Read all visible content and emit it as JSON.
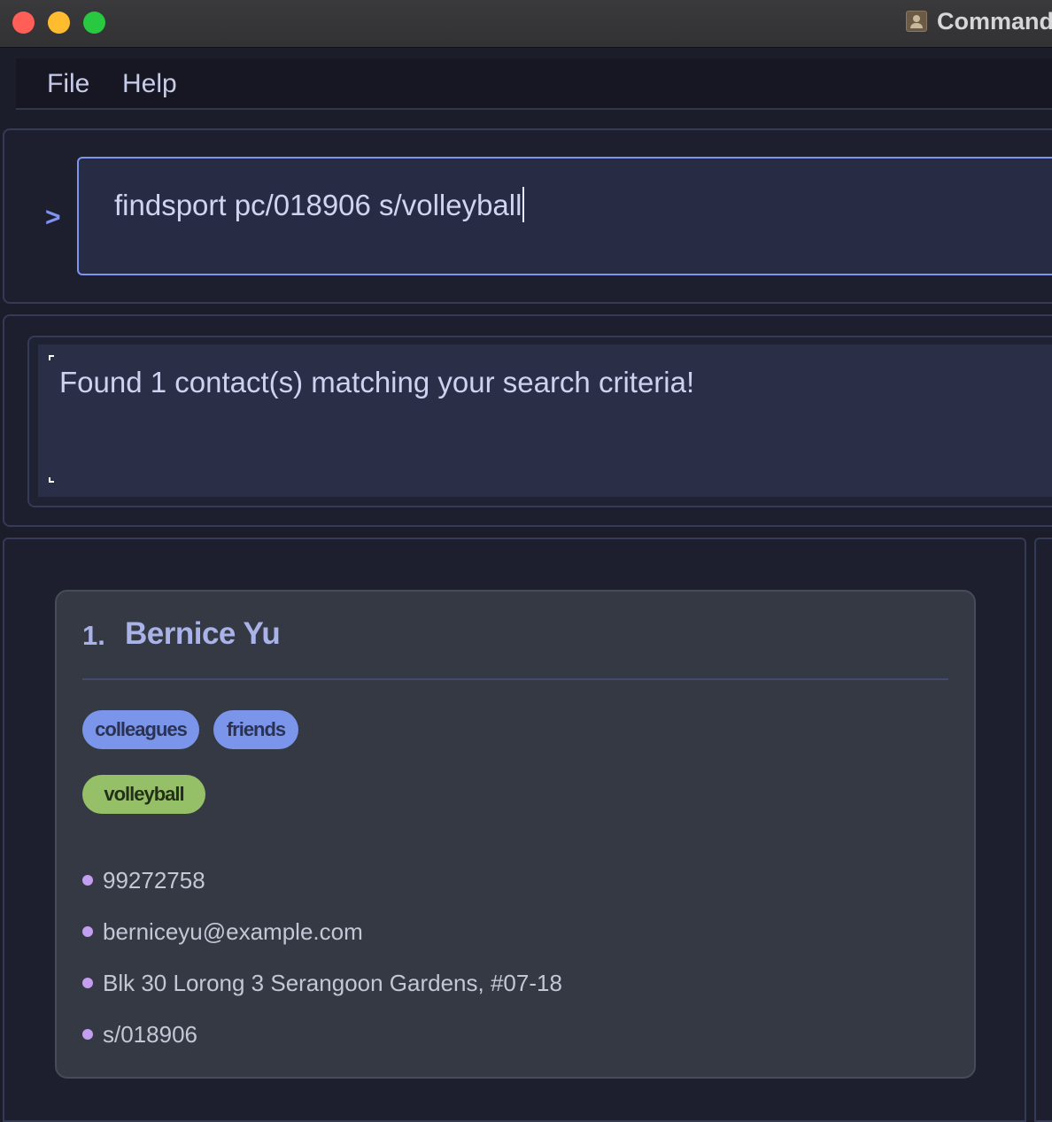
{
  "window": {
    "title": "Command"
  },
  "menu": {
    "file": "File",
    "help": "Help"
  },
  "command": {
    "prompt": ">",
    "value": "findsport pc/018906 s/volleyball"
  },
  "result": {
    "message": "Found 1 contact(s) matching your search criteria!"
  },
  "contacts": [
    {
      "index": "1.",
      "name": "Bernice Yu",
      "tags": [
        "colleagues",
        "friends"
      ],
      "sport_tags": [
        "volleyball"
      ],
      "phone": "99272758",
      "email": "berniceyu@example.com",
      "address": "Blk 30 Lorong 3 Serangoon Gardens, #07-18",
      "extra": "s/018906"
    }
  ],
  "colors": {
    "accent": "#7d95ec",
    "tag_blue": "#7a95ea",
    "tag_green": "#95c068",
    "bullet": "#c49ef0",
    "background": "#1b1d2a"
  }
}
